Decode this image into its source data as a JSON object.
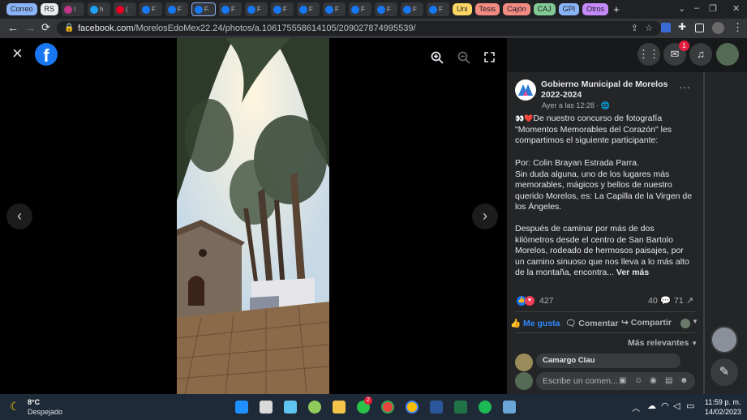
{
  "browser": {
    "bookmarks": [
      {
        "label": "Correo",
        "color": "#8ab4f8"
      },
      {
        "label": "RS",
        "color": "#e8eaed"
      },
      {
        "label": "Uni",
        "color": "#fdd663"
      },
      {
        "label": "Tesis",
        "color": "#f28b82"
      },
      {
        "label": "Cajón",
        "color": "#f28b82"
      },
      {
        "label": "CAJ",
        "color": "#81c995"
      },
      {
        "label": "GPI",
        "color": "#8ab4f8"
      },
      {
        "label": "Otros",
        "color": "#c58af9"
      }
    ],
    "tab_letters": [
      "I",
      "h",
      "(",
      "F",
      "F",
      "F.",
      "F",
      "F",
      "F",
      "F",
      "F",
      "F",
      "F",
      "F",
      "F"
    ],
    "new_tab": "+",
    "url_host": "facebook.com",
    "url_path": "/MorelosEdoMex22.24/photos/a.106175558614105/209027874995539/",
    "accent": "#8ab4f8"
  },
  "viewer": {
    "close_icon": "×",
    "fb_logo": "f",
    "prev_icon": "‹",
    "next_icon": "›"
  },
  "notifications": {
    "badge": "1"
  },
  "post": {
    "page_name": "Gobierno Municipal de Morelos 2022-2024",
    "time": "Ayer a las 12:28 ·",
    "paragraph1": "De nuestro concurso de fotografía \"Momentos Memorables del Corazón\" les compartimos el siguiente participante:",
    "paragraph2": "Por: Colin Brayan Estrada Parra.\nSin duda alguna, uno de los lugares más memorables, mágicos y bellos de nuestro querido Morelos, es: La Capilla de la Virgen de los Ángeles.",
    "paragraph3": "Después de caminar por más de dos kilómetros desde el centro de San Bartolo Morelos, rodeado de hermosos paisajes, por un camino sinuoso que nos lleva a lo más alto de la montaña, encontra...",
    "see_more": "Ver más",
    "reactions": "427",
    "comments": "40",
    "shares": "71",
    "like_label": "Me gusta",
    "comment_label": "Comentar",
    "share_label": "Compartir",
    "sort_label": "Más relevantes",
    "first_commenter": "Camargo Clau",
    "comment_placeholder": "Escribe un comen..."
  },
  "taskbar": {
    "weather_temp": "8°C",
    "weather_desc": "Despejado",
    "time": "11:59 p. m.",
    "date": "14/02/2023",
    "badge_a": "2"
  }
}
